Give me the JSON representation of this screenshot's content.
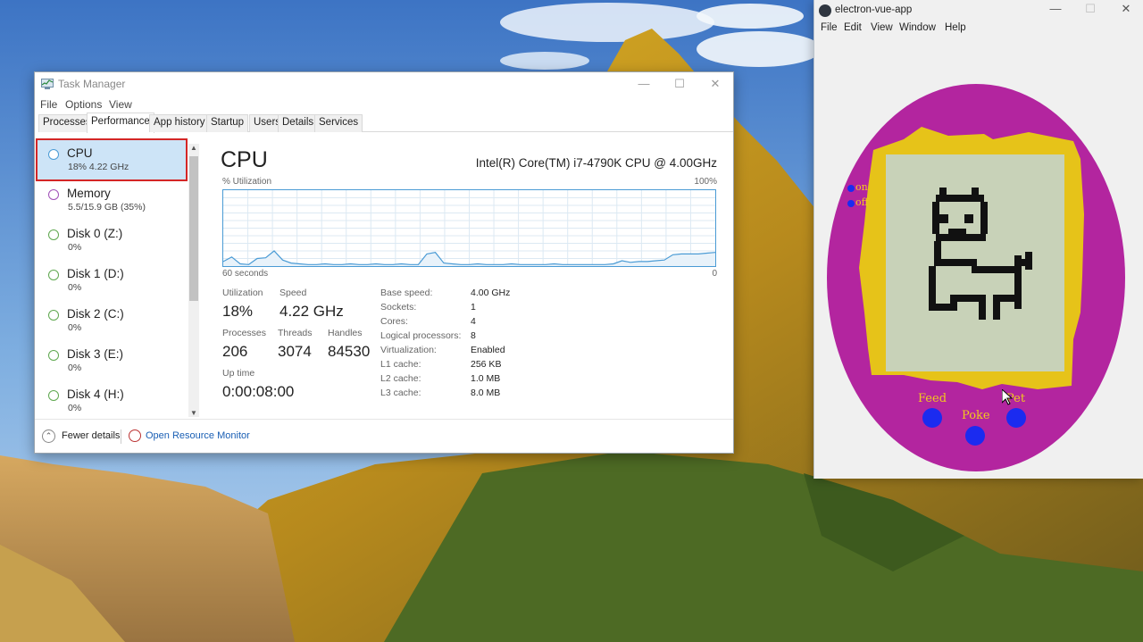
{
  "colors": {
    "accent": "#4a9bd5",
    "highlight_border": "#d42626",
    "egg_purple": "#b3259f",
    "egg_yellow": "#e6c319",
    "screen_green": "#c8d2b8",
    "button_blue": "#1b2bf0"
  },
  "task_manager": {
    "title": "Task Manager",
    "menu": [
      "File",
      "Options",
      "View"
    ],
    "tabs": [
      "Processes",
      "Performance",
      "App history",
      "Startup",
      "Users",
      "Details",
      "Services"
    ],
    "active_tab": "Performance",
    "sidebar": [
      {
        "name": "CPU",
        "value": "18%  4.22 GHz",
        "dot": "#4a9bd5",
        "selected": true
      },
      {
        "name": "Memory",
        "value": "5.5/15.9 GB (35%)",
        "dot": "#a050b8"
      },
      {
        "name": "Disk 0 (Z:)",
        "value": "0%",
        "dot": "#5fa84f"
      },
      {
        "name": "Disk 1 (D:)",
        "value": "0%",
        "dot": "#5fa84f"
      },
      {
        "name": "Disk 2 (C:)",
        "value": "0%",
        "dot": "#5fa84f"
      },
      {
        "name": "Disk 3 (E:)",
        "value": "0%",
        "dot": "#5fa84f"
      },
      {
        "name": "Disk 4 (H:)",
        "value": "0%",
        "dot": "#5fa84f"
      }
    ],
    "cpu": {
      "heading": "CPU",
      "model": "Intel(R) Core(TM) i7-4790K CPU @ 4.00GHz",
      "graph_label": "% Utilization",
      "graph_max": "100%",
      "graph_time": "60 seconds",
      "graph_min": "0",
      "utilization_label": "Utilization",
      "utilization": "18%",
      "speed_label": "Speed",
      "speed": "4.22 GHz",
      "processes_label": "Processes",
      "processes": "206",
      "threads_label": "Threads",
      "threads": "3074",
      "handles_label": "Handles",
      "handles": "84530",
      "uptime_label": "Up time",
      "uptime": "0:00:08:00",
      "specs": [
        {
          "label": "Base speed:",
          "value": "4.00 GHz"
        },
        {
          "label": "Sockets:",
          "value": "1"
        },
        {
          "label": "Cores:",
          "value": "4"
        },
        {
          "label": "Logical processors:",
          "value": "8"
        },
        {
          "label": "Virtualization:",
          "value": "Enabled"
        },
        {
          "label": "L1 cache:",
          "value": "256 KB"
        },
        {
          "label": "L2 cache:",
          "value": "1.0 MB"
        },
        {
          "label": "L3 cache:",
          "value": "8.0 MB"
        }
      ],
      "history": [
        6,
        12,
        3,
        2,
        10,
        11,
        20,
        8,
        4,
        3,
        2,
        2,
        3,
        2,
        2,
        3,
        2,
        2,
        3,
        2,
        2,
        3,
        2,
        2,
        16,
        18,
        4,
        3,
        2,
        2,
        3,
        2,
        2,
        2,
        3,
        2,
        2,
        2,
        2,
        3,
        2,
        2,
        2,
        2,
        2,
        2,
        3,
        7,
        5,
        6,
        6,
        7,
        8,
        15,
        16,
        16,
        16,
        17,
        18
      ]
    },
    "footer": {
      "fewer_details": "Fewer details",
      "resource_monitor": "Open Resource Monitor"
    }
  },
  "electron": {
    "title": "electron-vue-app",
    "menu": [
      "File",
      "Edit",
      "View",
      "Window",
      "Help"
    ],
    "power_on": "on",
    "power_off": "off",
    "feed": "Feed",
    "poke": "Poke",
    "pet": "Pet"
  }
}
